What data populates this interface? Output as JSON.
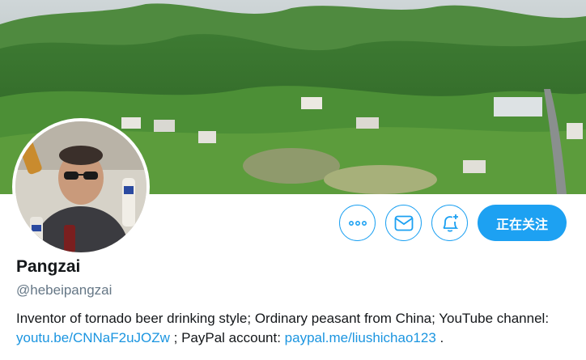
{
  "profile": {
    "display_name": "Pangzai",
    "handle": "@hebeipangzai",
    "bio": {
      "part1": "Inventor of tornado beer drinking style; Ordinary peasant from China; YouTube channel: ",
      "link1": "youtu.be/CNNaF2uJOZw",
      "part2": " ; PayPal account: ",
      "link2": "paypal.me/liushichao123",
      "part3": " ."
    }
  },
  "actions": {
    "more_icon": "more-dots-icon",
    "message_icon": "envelope-icon",
    "notify_icon": "bell-plus-icon",
    "follow_label": "正在关注"
  },
  "banner": {
    "description_icon": "mountain-village-photo"
  },
  "colors": {
    "accent": "#1da1f2",
    "link": "#1b95e0",
    "handle_gray": "#657786",
    "text": "#14171a"
  }
}
